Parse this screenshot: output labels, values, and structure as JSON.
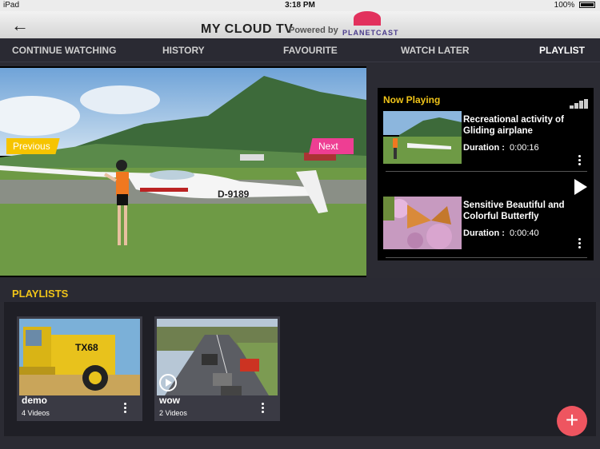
{
  "status": {
    "device": "iPad",
    "time": "3:18 PM",
    "battery": "100%"
  },
  "header": {
    "title": "MY CLOUD TV",
    "powered_by": "Powered by",
    "partner": "PLANETCAST"
  },
  "tabs": [
    {
      "label": "CONTINUE WATCHING"
    },
    {
      "label": "HISTORY"
    },
    {
      "label": "FAVOURITE"
    },
    {
      "label": "WATCH LATER"
    },
    {
      "label": "PLAYLIST",
      "active": true
    }
  ],
  "player": {
    "previous_label": "Previous",
    "next_label": "Next",
    "plane_registration": "D-9189"
  },
  "now_playing": {
    "title": "Now Playing",
    "items": [
      {
        "title": "Recreational activity of Gliding airplane",
        "duration_label": "Duration :",
        "duration": "0:00:16"
      },
      {
        "title": "Sensitive Beautiful and Colorful Butterfly",
        "duration_label": "Duration :",
        "duration": "0:00:40"
      }
    ]
  },
  "playlists": {
    "title": "PLAYLISTS",
    "items": [
      {
        "name": "demo",
        "count": "4 Videos",
        "thumb_text": "TX68"
      },
      {
        "name": "wow",
        "count": "2 Videos"
      }
    ]
  },
  "colors": {
    "accent_yellow": "#f0c419",
    "next_pink": "#ee3e93",
    "fab_red": "#ee5560"
  }
}
